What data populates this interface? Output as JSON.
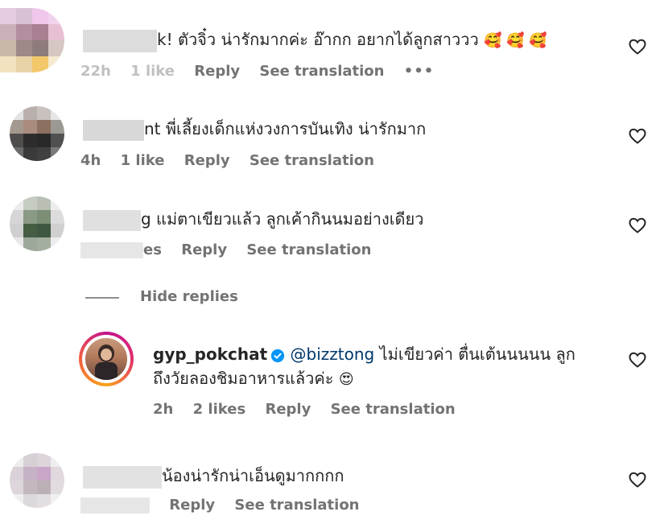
{
  "comments": [
    {
      "text": "k! ตัวจิ๋ว น่ารักมากค่ะ อ๊ากก อยากได้ลูกสาววว",
      "emoji": "🥰 🥰 🥰",
      "meta_time": "22h",
      "meta_likes": "1 like",
      "reply": "Reply",
      "see_translation": "See translation",
      "more": "•••"
    },
    {
      "text": "nt พี่เลี้ยงเด็กแห่งวงการบันเทิง น่ารักมาก",
      "meta_time": "4h",
      "meta_likes": "1 like",
      "reply": "Reply",
      "see_translation": "See translation"
    },
    {
      "text": "g แม่ตาเขียวแล้ว ลูกเค้ากินนมอย่างเดียว",
      "meta_likes": "es",
      "reply": "Reply",
      "see_translation": "See translation"
    }
  ],
  "hide_replies": "Hide replies",
  "reply_comment": {
    "username": "gyp_pokchat",
    "mention": "@bizztong",
    "text_line1": "ไม่เขียวค่า ตื่นเต้นนนนน ลูก",
    "text_line2": "ถึงวัยลองชิมอาหารแล้วค่ะ",
    "emoji": "😍",
    "meta_time": "2h",
    "meta_likes": "2 likes",
    "reply": "Reply",
    "see_translation": "See translation"
  },
  "last_comment": {
    "text": "น้องน่ารักน่าเอ็นดูมากกกก",
    "reply": "Reply",
    "see_translation": "See translation"
  },
  "colors": {
    "verified": "#0095f6",
    "story_ring_start": "#f9a31b",
    "story_ring_end": "#c1138d"
  }
}
